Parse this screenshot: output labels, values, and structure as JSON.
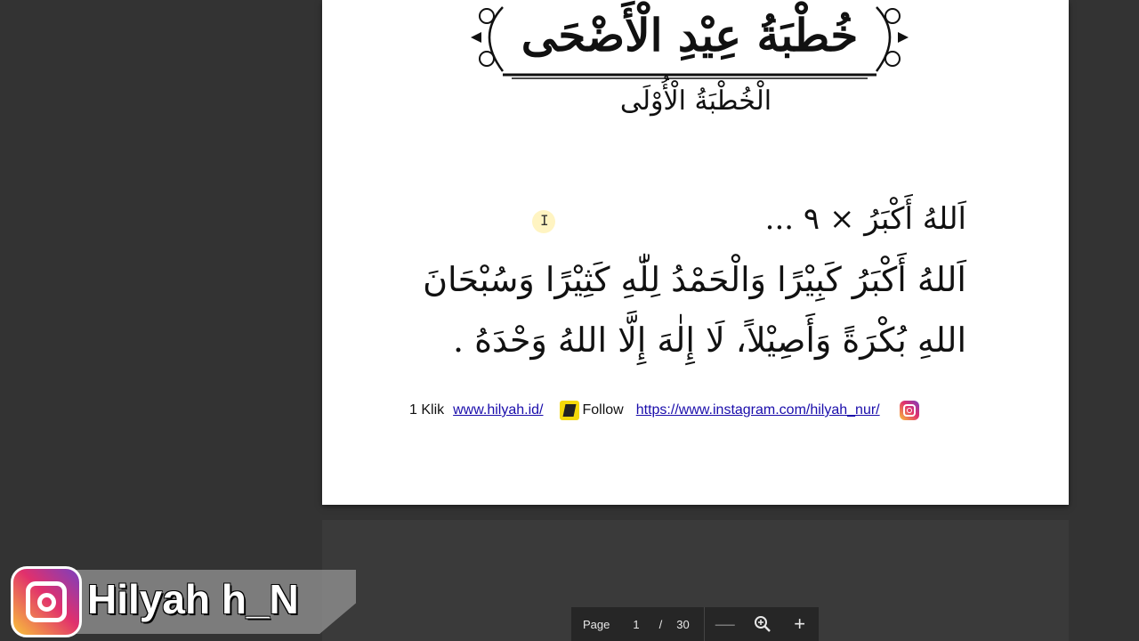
{
  "document": {
    "title": "خُطْبَةُ عِيْدِ الْأَضْحَى",
    "subtitle": "الْخُطْبَةُ الْأُوْلَى",
    "lines": [
      "اَللهُ أَكْبَرُ × ٩ ...",
      "اَللهُ أَكْبَرُ كَبِيْرًا وَالْحَمْدُ لِلّٰهِ كَثِيْرًا وَسُبْحَانَ",
      "اللهِ بُكْرَةً وَأَصِيْلاً، لَا إِلٰهَ إِلَّا اللهُ وَحْدَهُ ."
    ],
    "footer": {
      "klik_label": "1 Klik",
      "website_link": "www.hilyah.id/",
      "follow_label": "Follow",
      "instagram_link": "https://www.instagram.com/hilyah_nur/"
    }
  },
  "toolbar": {
    "page_label": "Page",
    "current_page": "1",
    "separator": "/",
    "total_pages": "30",
    "zoom_out_glyph": "—",
    "zoom_in_glyph": "+"
  },
  "watermark": {
    "text": "Hilyah h_N"
  },
  "colors": {
    "viewer_bg": "#333333",
    "link": "#1a0dab",
    "toolbar_bg": "#262626"
  }
}
